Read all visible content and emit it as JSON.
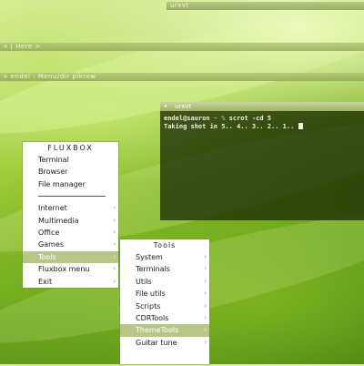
{
  "windows": {
    "top_bar_title": "urxvt",
    "bar2_title": "» | Here >",
    "bar3_title": "»  endel : Menu/dir  pikrow"
  },
  "terminal": {
    "title": "urxvt",
    "close_glyph": "◂",
    "prompt_user": "endel@sauron",
    "prompt_sep": " ~ % ",
    "command": "scrot -cd 5",
    "output": "Taking shot in 5.. 4.. 3.. 2.. 1.. "
  },
  "fluxbox_menu": {
    "title": "FLUXBOX",
    "top_items": [
      "Terminal",
      "Browser",
      "File manager"
    ],
    "items": [
      {
        "label": "Internet",
        "submenu": true
      },
      {
        "label": "Multimedia",
        "submenu": true
      },
      {
        "label": "Office",
        "submenu": true
      },
      {
        "label": "Games",
        "submenu": true
      },
      {
        "label": "Tools",
        "submenu": true,
        "highlighted": true
      },
      {
        "label": "Fluxbox menu",
        "submenu": true
      },
      {
        "label": "Exit",
        "submenu": true
      }
    ]
  },
  "tools_menu": {
    "title": "Tools",
    "items": [
      {
        "label": "System",
        "submenu": true
      },
      {
        "label": "Terminals",
        "submenu": true
      },
      {
        "label": "Utils",
        "submenu": true
      },
      {
        "label": "File utils",
        "submenu": true
      },
      {
        "label": "Scripts",
        "submenu": true
      },
      {
        "label": "CDRTools",
        "submenu": true
      },
      {
        "label": "ThemeTools",
        "submenu": true,
        "highlighted": true
      },
      {
        "label": "Guitar tune",
        "submenu": true
      }
    ]
  },
  "icons": {
    "arrow": "chevron-right-icon"
  },
  "colors": {
    "highlight": "#b7c78a",
    "terminal_bg": "#1e2d05"
  }
}
